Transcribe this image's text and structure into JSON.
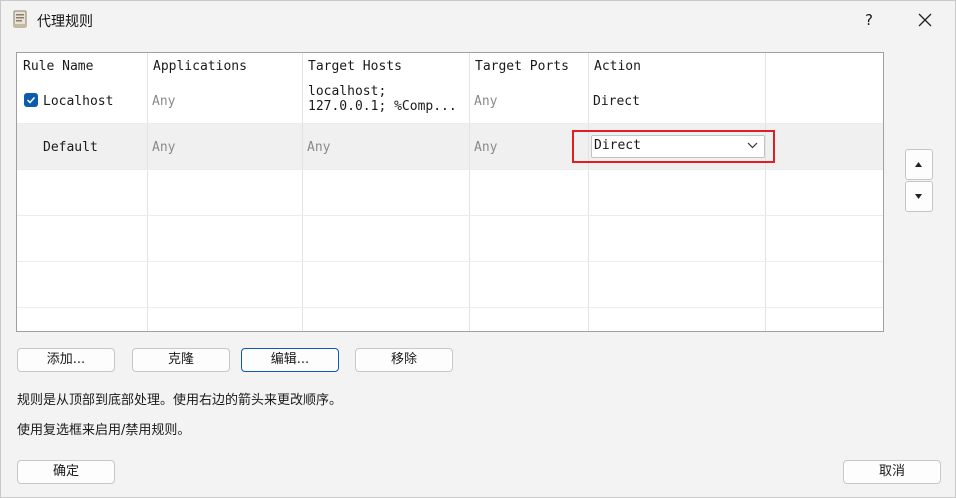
{
  "window": {
    "title": "代理规则",
    "help_label": "?"
  },
  "table": {
    "columns": [
      "Rule Name",
      "Applications",
      "Target Hosts",
      "Target Ports",
      "Action"
    ],
    "rows": [
      {
        "checked": true,
        "name": "Localhost",
        "applications": "Any",
        "target_hosts_line1": "localhost;",
        "target_hosts_line2": "127.0.0.1; %Comp...",
        "target_ports": "Any",
        "action": "Direct"
      },
      {
        "name": "Default",
        "applications": "Any",
        "target_hosts": "Any",
        "target_ports": "Any",
        "action": "Direct"
      }
    ]
  },
  "buttons": {
    "add": "添加...",
    "clone": "克隆",
    "edit": "编辑...",
    "remove": "移除",
    "ok": "确定",
    "cancel": "取消"
  },
  "notes": {
    "order": "规则是从顶部到底部处理。使用右边的箭头来更改顺序。",
    "enable": "使用复选框来启用/禁用规则。"
  },
  "colors": {
    "accent": "#0b5cad",
    "highlight": "#e02020"
  }
}
